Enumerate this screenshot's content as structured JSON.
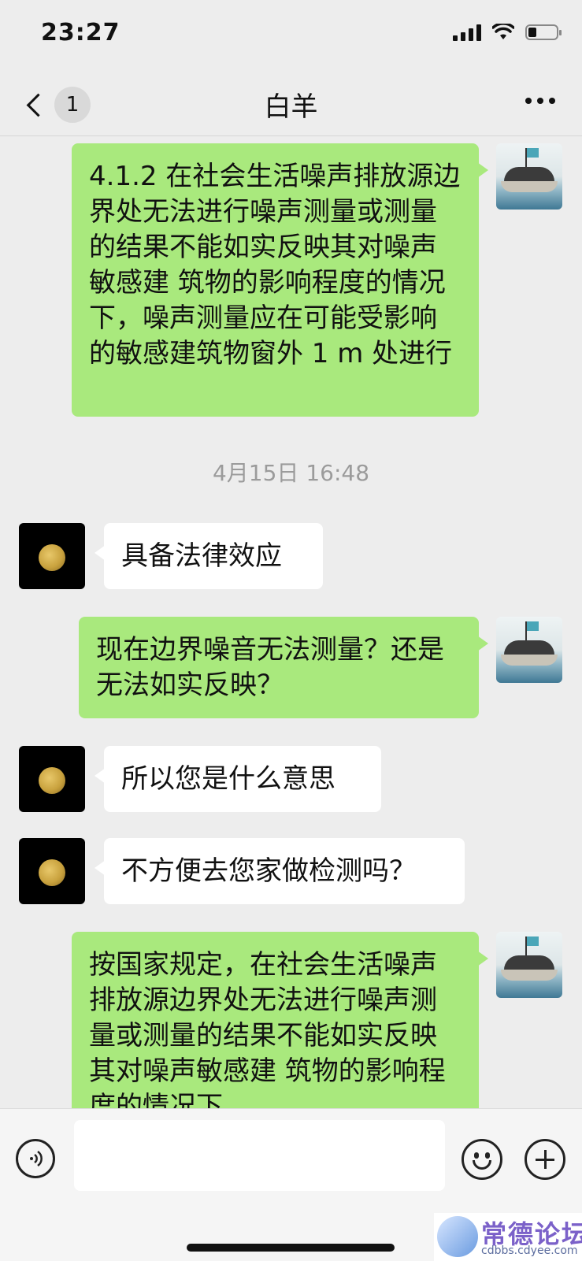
{
  "status_bar": {
    "time": "23:27",
    "battery_level": 0.3
  },
  "header": {
    "back_badge": "1",
    "title": "白羊",
    "more_icon": "more-dots-icon"
  },
  "messages": [
    {
      "type": "outgoing",
      "text": "4.1.2 在社会生活噪声排放源边界处无法进行噪声测量或测量的结果不能如实反映其对噪声敏感建 筑物的影响程度的情况下，噪声测量应在可能受影响的敏感建筑物窗外 1 m 处进行"
    },
    {
      "type": "timestamp",
      "text": "4月15日 16:48"
    },
    {
      "type": "incoming",
      "text": "具备法律效应"
    },
    {
      "type": "outgoing",
      "text": "现在边界噪音无法测量？还是无法如实反映？"
    },
    {
      "type": "incoming",
      "text": "所以您是什么意思"
    },
    {
      "type": "incoming",
      "text": "不方便去您家做检测吗？"
    },
    {
      "type": "outgoing",
      "text": "按国家规定，在社会生活噪声排放源边界处无法进行噪声测量或测量的结果不能如实反映其对噪声敏感建 筑物的影响程度的情况下，"
    }
  ],
  "input_bar": {
    "placeholder": "",
    "value": ""
  },
  "watermark": {
    "title": "常德论坛",
    "url": "cdbbs.cdyee.com"
  }
}
